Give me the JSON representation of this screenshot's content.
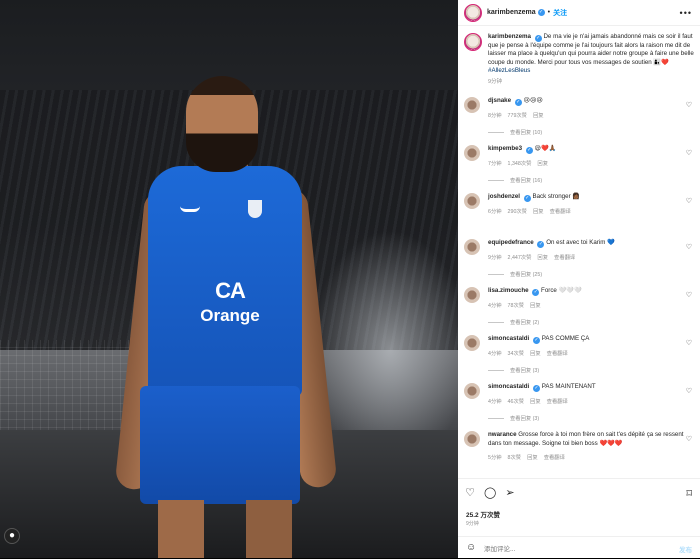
{
  "post": {
    "author": "karimbenzema",
    "follow_label": "关注",
    "photo": {
      "sponsor_logo": "CA",
      "sponsor_name": "Orange"
    }
  },
  "caption": {
    "author": "karimbenzema",
    "text": "De ma vie je n'ai jamais abandonné mais ce soir il faut que je pense à l'équipe comme je l'ai toujours fait alors la raison me dit de laisser ma place à quelqu'un qui pourra aider notre groupe à faire une belle coupe du monde. Merci pour tous vos messages de soutien 👩‍👦❤️",
    "hashtag": "#AllezLesBleus",
    "time": "9分钟"
  },
  "comments": [
    {
      "user": "djsnake",
      "verified": true,
      "text": "😢😢😢",
      "time": "8分钟",
      "likes": "779次赞",
      "reply": "回复",
      "translate": "",
      "replies": "查看回复 (10)"
    },
    {
      "user": "kimpembe3",
      "verified": true,
      "text": "😪❤️🙏🏾",
      "time": "7分钟",
      "likes": "1,348次赞",
      "reply": "回复",
      "translate": "",
      "replies": "查看回复 (16)"
    },
    {
      "user": "joshdenzel",
      "verified": true,
      "text": "Back stronger 👩🏾",
      "time": "6分钟",
      "likes": "290次赞",
      "reply": "回复",
      "translate": "查看翻译",
      "replies": ""
    },
    {
      "user": "equipedefrance",
      "verified": true,
      "text": "On est avec toi Karim 💙",
      "time": "9分钟",
      "likes": "2,447次赞",
      "reply": "回复",
      "translate": "查看翻译",
      "replies": "查看回复 (25)"
    },
    {
      "user": "lisa.zimouche",
      "verified": true,
      "text": "Force 🤍🤍🤍",
      "time": "4分钟",
      "likes": "78次赞",
      "reply": "回复",
      "translate": "",
      "replies": "查看回复 (2)"
    },
    {
      "user": "simoncastaldi",
      "verified": true,
      "text": "PAS COMME ÇA",
      "time": "4分钟",
      "likes": "34次赞",
      "reply": "回复",
      "translate": "查看翻译",
      "replies": "查看回复 (3)"
    },
    {
      "user": "simoncastaldi",
      "verified": true,
      "text": "PAS MAINTENANT",
      "time": "4分钟",
      "likes": "46次赞",
      "reply": "回复",
      "translate": "查看翻译",
      "replies": "查看回复 (3)"
    },
    {
      "user": "nwarance",
      "verified": false,
      "text": "Grosse force à toi mon frère on sait t'es dépité ça se ressent dans ton message. Soigne toi bien boss ❤️❤️❤️",
      "time": "5分钟",
      "likes": "8次赞",
      "reply": "回复",
      "translate": "查看翻译",
      "replies": ""
    }
  ],
  "footer": {
    "likes": "25.2 万次赞",
    "ago": "9分钟",
    "add_placeholder": "添加评论...",
    "post_label": "发布"
  },
  "colors": {
    "accent": "#0095f6",
    "verified": "#3897f0",
    "jersey": "#1d6ad8"
  },
  "icons": [
    "heart-icon",
    "comment-icon",
    "share-icon",
    "bookmark-icon",
    "emoji-icon",
    "more-icon",
    "user-tag-icon"
  ]
}
